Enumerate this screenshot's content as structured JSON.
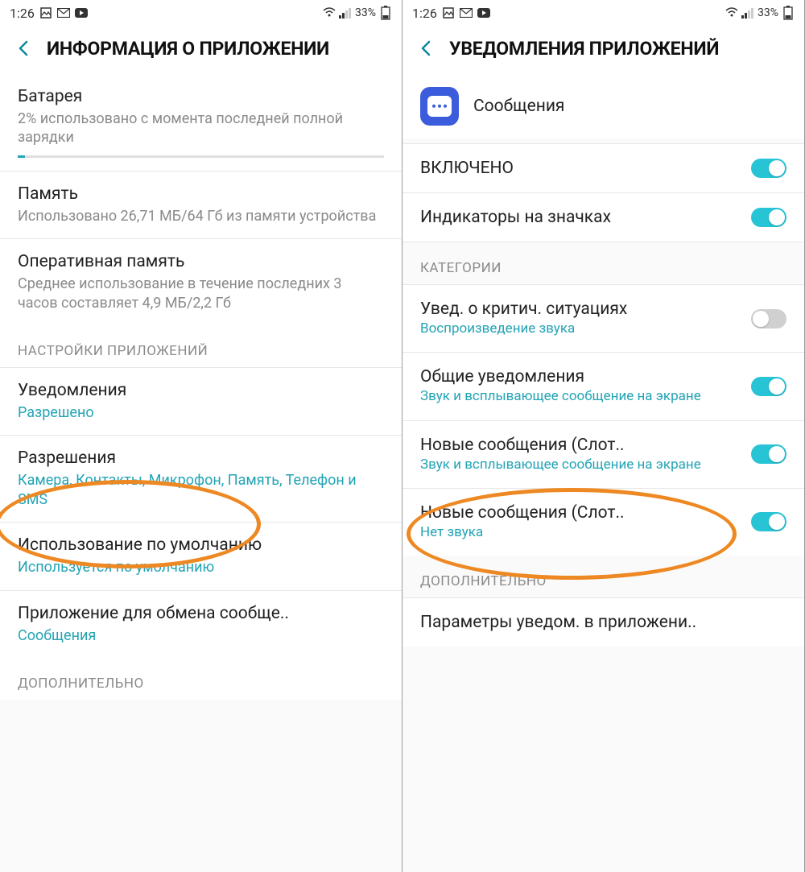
{
  "status": {
    "time": "1:26",
    "battery_text": "33%"
  },
  "screen1": {
    "header": "ИНФОРМАЦИЯ О ПРИЛОЖЕНИИ",
    "items": [
      {
        "title": "Батарея",
        "sub": "2% использовано с момента последней полной зарядки"
      },
      {
        "title": "Память",
        "sub": "Использовано 26,71 МБ/64 Гб из памяти устройства"
      },
      {
        "title": "Оперативная память",
        "sub": "Среднее использование в течение последних 3 часов составляет 4,9 МБ/2,2 Гб"
      }
    ],
    "section1": "НАСТРОЙКИ ПРИЛОЖЕНИЙ",
    "items2": [
      {
        "title": "Уведомления",
        "sub": "Разрешено"
      },
      {
        "title": "Разрешения",
        "sub": "Камера, Контакты, Микрофон, Память, Телефон и SMS"
      },
      {
        "title": "Использование по умолчанию",
        "sub": "Используется по умолчанию"
      },
      {
        "title": "Приложение для обмена сообще..",
        "sub": "Сообщения"
      }
    ],
    "section2": "ДОПОЛНИТЕЛЬНО"
  },
  "screen2": {
    "header": "УВЕДОМЛЕНИЯ ПРИЛОЖЕНИЙ",
    "app_name": "Сообщения",
    "enabled": "ВКЛЮЧЕНО",
    "badge_row": "Индикаторы на значках",
    "section_cat": "КАТЕГОРИИ",
    "cats": [
      {
        "title": "Увед. о критич. ситуациях",
        "sub": "Воспроизведение звука",
        "on": false
      },
      {
        "title": "Общие уведомления",
        "sub": "Звук и всплывающее сообщение на экране",
        "on": true
      },
      {
        "title": "Новые сообщения (Слот..",
        "sub": "Звук и всплывающее сообщение на экране",
        "on": true
      },
      {
        "title": "Новые сообщения (Слот..",
        "sub": "Нет звука",
        "on": true
      }
    ],
    "section_more": "ДОПОЛНИТЕЛЬНО",
    "more_row": "Параметры уведом. в приложени.."
  }
}
